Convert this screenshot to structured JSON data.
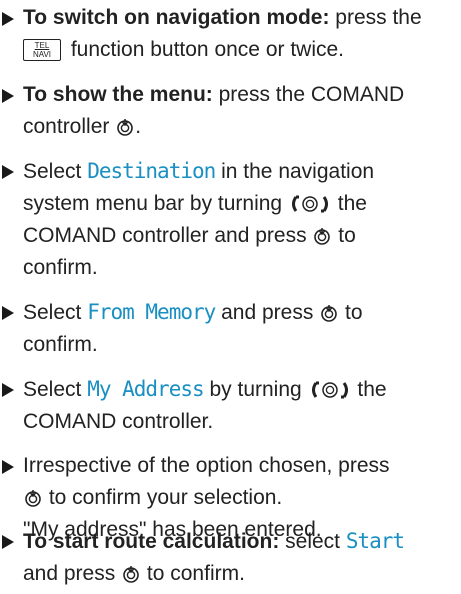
{
  "steps": [
    {
      "lead": "To switch on navigation mode:",
      "t1": " press the",
      "button": {
        "top": "TEL",
        "bottom": "NAVI"
      },
      "t2": " function button once or twice."
    },
    {
      "lead": "To show the menu:",
      "t1": " press the COMAND",
      "t2": "controller ",
      "t3": "."
    },
    {
      "t1": "Select ",
      "item": "Destination",
      "t2": " in the navigation",
      "t3": "system menu bar by turning ",
      "t4": " the",
      "t5": "COMAND controller and press ",
      "t6": " to",
      "t7": "confirm."
    },
    {
      "t1": "Select ",
      "item": "From Memory",
      "t2": " and press ",
      "t3": " to",
      "t4": "confirm."
    },
    {
      "t1": "Select ",
      "item": "My Address",
      "t2": " by turning ",
      "t3": " the",
      "t4": "COMAND controller."
    },
    {
      "t1": "Irrespective of the option chosen, press",
      "t2": " to confirm your selection.",
      "t3": "\"My address\" has been entered."
    },
    {
      "lead": "To start route calculation:",
      "t1": " select ",
      "item": "Start",
      "t2": "and press ",
      "t3": " to confirm."
    }
  ]
}
